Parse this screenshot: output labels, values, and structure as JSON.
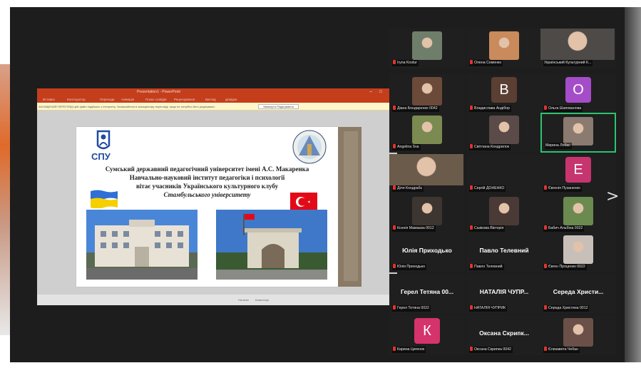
{
  "colors": {
    "ppt_accent": "#c43e1c",
    "active_speaker_border": "#2ac56e",
    "mic_muted": "#e0352b"
  },
  "ppt": {
    "title": "Presentation1 - PowerPoint",
    "window_controls": [
      "–",
      "□",
      "✕"
    ],
    "menu": [
      "Вставка",
      "Конструктор",
      "Переходи",
      "Анімація",
      "Показ слайдів",
      "Рецензування",
      "Вигляд",
      "Довідка"
    ],
    "info_message": "ЗАХИЩЕНИЙ ПЕРЕГЛЯД Цей файл надійшло з Інтернету. Залишайтеся в захищеному перегляді, якщо не потрібно його редагувати.",
    "info_button": "Увімкнути Редагування",
    "status_left": "Нотатки",
    "status_right": "Коментарі"
  },
  "slide": {
    "logo_text": "СПУ",
    "line1": "Сумський державний педагогічний університет імені А.С. Макаренка",
    "line2": "Навчально-науковий інститут педагогіки і психології",
    "line3": "вітає учасників Українського культурного клубу",
    "line4": "Стамбульського університету"
  },
  "participants": [
    {
      "name": "Iryna Kostur",
      "type": "photo",
      "av": "#6f7e6a"
    },
    {
      "name": "Олена Семенко",
      "type": "photo",
      "av": "#c98a5c"
    },
    {
      "name": "Український Культурний К...",
      "type": "photo-wide",
      "av": "#4d4a48",
      "nomic": true
    },
    {
      "name": "Діана Бондаренко 0042",
      "type": "photo",
      "av": "#6b4a3a"
    },
    {
      "name": "Владислава Андібор",
      "type": "letter",
      "letter": "В",
      "color": "#5b3f32"
    },
    {
      "name": "Ольга Шаповалова",
      "type": "letter",
      "letter": "О",
      "color": "#a54dc8"
    },
    {
      "name": "Angelina Sva",
      "type": "photo",
      "av": "#7a8a50"
    },
    {
      "name": "Світлана Кондратюк",
      "type": "photo",
      "av": "#5a4a48"
    },
    {
      "name": "Мирина Лобас",
      "type": "photo",
      "av": "#8a7a70",
      "active": true,
      "nomic": true
    },
    {
      "name": "Діля Кондрабє",
      "type": "photo-wide",
      "av": "#6b5b4a"
    },
    {
      "name": "Сергій ДОНЕНКО",
      "type": "blank"
    },
    {
      "name": "Євгенія Пузаненко",
      "type": "letter",
      "letter": "Е",
      "color": "#c7356f"
    },
    {
      "name": "Ксенія Мамаєва 0012",
      "type": "photo",
      "av": "#3d3530"
    },
    {
      "name": "Сазікова Вікторія",
      "type": "photo",
      "av": "#4a3a36"
    },
    {
      "name": "Бабич Альбіна 0022",
      "type": "photo",
      "av": "#6a8a50"
    },
    {
      "name": "Юлія Приходько",
      "type": "text",
      "bigname": "Юлія Приходько"
    },
    {
      "name": "Павло Телевний",
      "type": "text",
      "bigname": "Павло Телевний"
    },
    {
      "name": "Євген Проценко 0022",
      "type": "photo",
      "av": "#c8c0b8"
    },
    {
      "name": "Герел Тетяна 0022",
      "type": "text",
      "bigname": "Герел Тетяна 00..."
    },
    {
      "name": "НАТАЛІЯ ЧУПРИК",
      "type": "text",
      "bigname": "НАТАЛІЯ ЧУПР..."
    },
    {
      "name": "Середа Христина 0012",
      "type": "text",
      "bigname": "Середа Христи..."
    },
    {
      "name": "Карина Цигенок",
      "type": "letter",
      "letter": "К",
      "color": "#d4336c"
    },
    {
      "name": "Оксана Скрипка 0042",
      "type": "text",
      "bigname": "Оксана Скрипк..."
    },
    {
      "name": "Єлизавета Чебан",
      "type": "photo",
      "av": "#6a5048"
    }
  ],
  "next_arrow": ">"
}
